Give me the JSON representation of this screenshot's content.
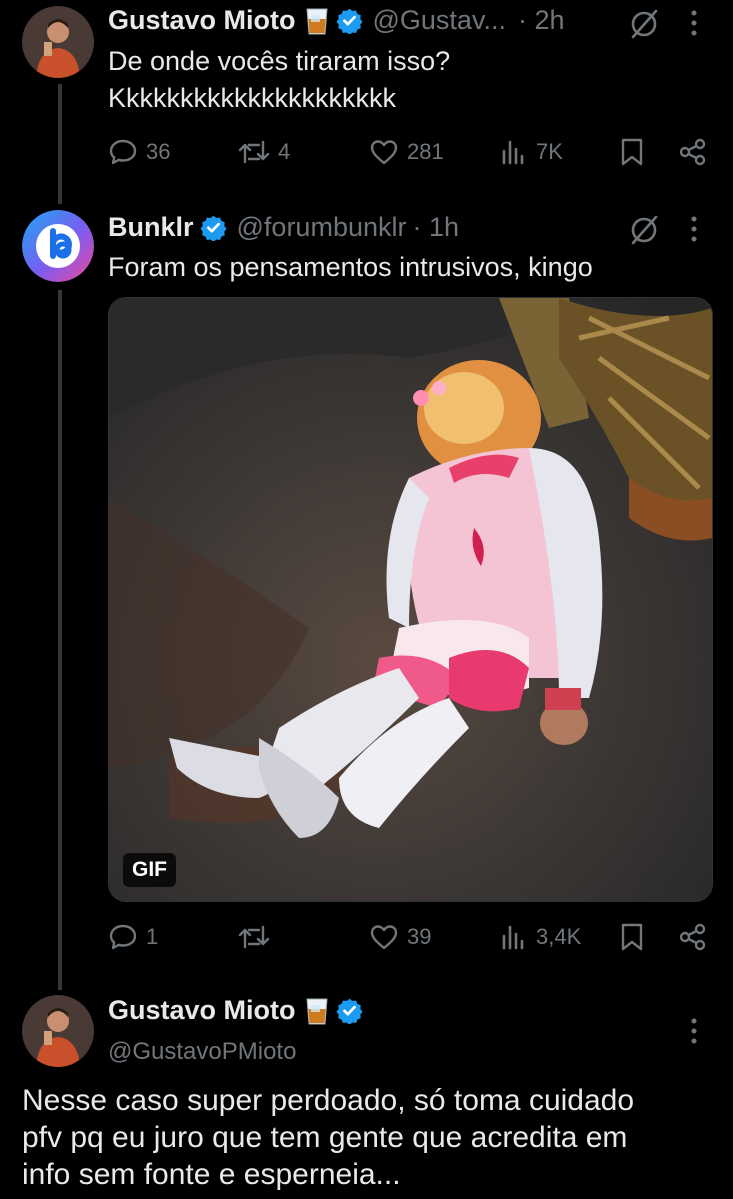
{
  "colors": {
    "background": "#000000",
    "text": "#e7e9ea",
    "muted": "#71767b",
    "verified": "#1d9bf0",
    "line": "#333639"
  },
  "tweet1": {
    "name": "Gustavo Mioto",
    "handle": "@Gustav...",
    "time": "· 2h",
    "text_lines": [
      "De onde vocês tiraram isso?",
      "Kkkkkkkkkkkkkkkkkkkkk"
    ],
    "replies": "36",
    "retweets": "4",
    "likes": "281",
    "views": "7K"
  },
  "tweet2": {
    "name": "Bunklr",
    "handle": "@forumbunklr",
    "time": "· 1h",
    "text": "Foram os pensamentos intrusivos, kingo",
    "media_badge": "GIF",
    "replies": "1",
    "retweets": "",
    "likes": "39",
    "views": "3,4K"
  },
  "tweet3": {
    "name": "Gustavo Mioto",
    "handle": "@GustavoPMioto",
    "text_lines": [
      "Nesse caso super perdoado, só toma cuidado",
      "pfv pq eu juro que tem gente que acredita em",
      "info sem fonte e esperneia..."
    ]
  },
  "icons": [
    "comment-icon",
    "retweet-icon",
    "heart-icon",
    "views-icon",
    "bookmark-icon",
    "share-icon",
    "more-icon",
    "grok-icon",
    "verified-icon",
    "whiskey-emoji"
  ]
}
